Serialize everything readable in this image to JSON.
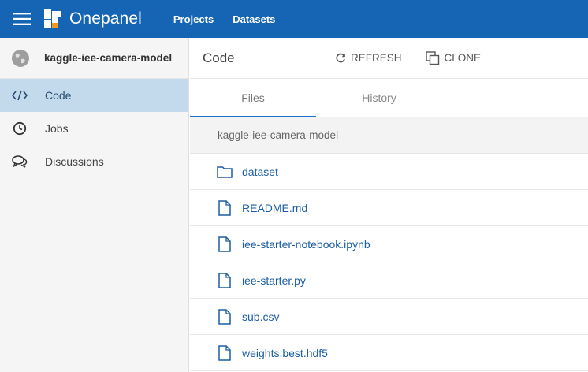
{
  "app": {
    "name": "Onepanel",
    "nav": [
      "Projects",
      "Datasets"
    ]
  },
  "sidebar": {
    "project_name": "kaggle-iee-camera-model",
    "items": [
      {
        "label": "Code",
        "icon": "code-icon",
        "active": true
      },
      {
        "label": "Jobs",
        "icon": "clock-icon",
        "active": false
      },
      {
        "label": "Discussions",
        "icon": "chat-icon",
        "active": false
      }
    ]
  },
  "main": {
    "title": "Code",
    "refresh_label": "REFRESH",
    "clone_label": "CLONE",
    "tabs": [
      {
        "label": "Files",
        "active": true
      },
      {
        "label": "History",
        "active": false
      }
    ],
    "path": "kaggle-iee-camera-model",
    "files": [
      {
        "name": "dataset",
        "type": "folder"
      },
      {
        "name": "README.md",
        "type": "file"
      },
      {
        "name": "iee-starter-notebook.ipynb",
        "type": "file"
      },
      {
        "name": "iee-starter.py",
        "type": "file"
      },
      {
        "name": "sub.csv",
        "type": "file"
      },
      {
        "name": "weights.best.hdf5",
        "type": "file"
      }
    ]
  },
  "colors": {
    "brand": "#1565b4",
    "active_item_bg": "#c3d9ec",
    "link": "#1b5ea3"
  }
}
